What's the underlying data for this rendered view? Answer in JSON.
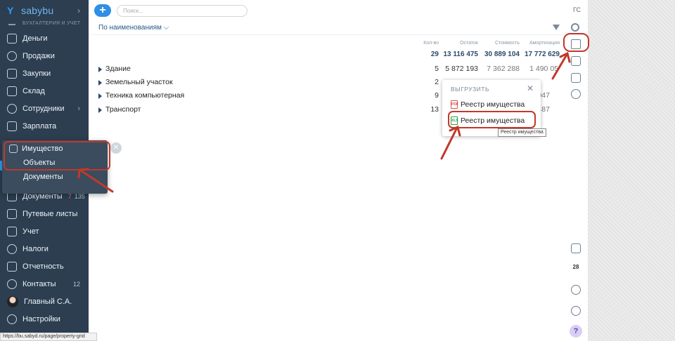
{
  "brand": {
    "name": "sabybu",
    "section_caption": "БУХГАЛТЕРИЯ И УЧЕТ"
  },
  "sidebar": {
    "items": [
      {
        "label": "Деньги"
      },
      {
        "label": "Продажи"
      },
      {
        "label": "Закупки"
      },
      {
        "label": "Склад"
      },
      {
        "label": "Сотрудники"
      },
      {
        "label": "Зарплата"
      },
      {
        "label": "Документы",
        "count_red": "7",
        "count": "135"
      },
      {
        "label": "Путевые листы"
      },
      {
        "label": "Учет"
      },
      {
        "label": "Налоги"
      },
      {
        "label": "Отчетность"
      },
      {
        "label": "Контакты",
        "count": "12"
      },
      {
        "label": "Главный С.А."
      },
      {
        "label": "Настройки"
      }
    ],
    "submenu": {
      "header": "Имущество",
      "items": [
        "Объекты",
        "Документы"
      ]
    }
  },
  "status_url": "https://bu.sabyd.ru/page/property-grid",
  "topbar": {
    "add_label": "+",
    "search_placeholder": "Поиск...",
    "user_initials": "ГС"
  },
  "toolbar": {
    "sort_label": "По наименованиям ⌵"
  },
  "table": {
    "columns": [
      "Кол-во",
      "Остаток",
      "Стоимость",
      "Амортизация"
    ],
    "totals": [
      "29",
      "13 116 475",
      "30 889 104",
      "17 772 629"
    ],
    "rows": [
      {
        "name": "Здание",
        "qty": "5",
        "rest": "5 872 193",
        "cost": "7 362 288",
        "amort": "1 490 05"
      },
      {
        "name": "Земельный участок",
        "qty": "2",
        "rest": "",
        "cost": "",
        "amort": ""
      },
      {
        "name": "Техника компьютерная",
        "qty": "9",
        "rest": "",
        "cost": "",
        "amort": "047"
      },
      {
        "name": "Транспорт",
        "qty": "13",
        "rest": "",
        "cost": "",
        "amort": "487"
      }
    ]
  },
  "export_popup": {
    "title": "ВЫГРУЗИТЬ",
    "items": [
      {
        "label": "Реестр имущества",
        "icon": "pdf-file-icon",
        "icon_text": "PDF"
      },
      {
        "label": "Реестр имущества",
        "icon": "excel-file-icon",
        "icon_text": "XLS"
      }
    ],
    "tooltip": "Реестр имущества"
  },
  "right_panel": {
    "calendar_day": "28",
    "help": "?"
  },
  "colors": {
    "sidebar": "#2c3e50",
    "accent": "#2f8fe6",
    "highlight": "#c0392b"
  }
}
